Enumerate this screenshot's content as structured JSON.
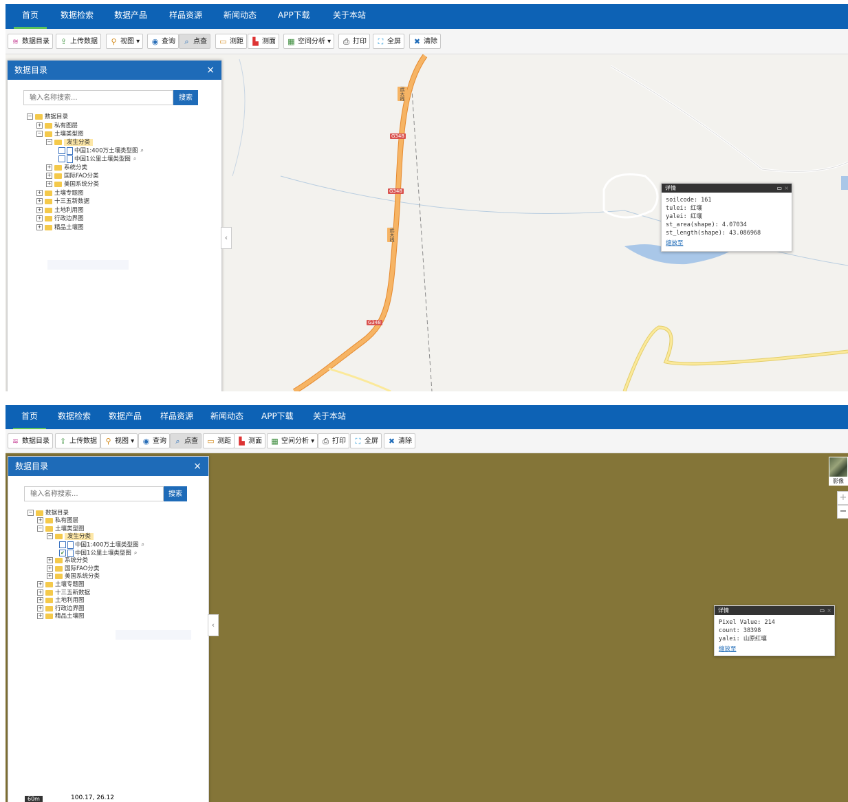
{
  "nav": {
    "items": [
      "首页",
      "数据检索",
      "数据产品",
      "样品资源",
      "新闻动态",
      "APP下载",
      "关于本站"
    ]
  },
  "toolbar": {
    "buttons": [
      {
        "label": "数据目录",
        "icon": "layers-icon"
      },
      {
        "label": "上传数据",
        "icon": "upload-icon"
      },
      {
        "label": "视图 ▾",
        "icon": "view-icon"
      },
      {
        "label": "查询",
        "icon": "query-icon"
      },
      {
        "label": "点查",
        "icon": "point-query-icon"
      },
      {
        "label": "测距",
        "icon": "ruler-icon"
      },
      {
        "label": "测面",
        "icon": "area-icon"
      },
      {
        "label": "空间分析 ▾",
        "icon": "analysis-icon"
      },
      {
        "label": "打印",
        "icon": "print-icon"
      },
      {
        "label": "全屏",
        "icon": "fullscreen-icon"
      },
      {
        "label": "清除",
        "icon": "clear-icon"
      }
    ]
  },
  "panel": {
    "title": "数据目录",
    "close": "×",
    "search_placeholder": "输入名称搜索...",
    "search_button": "搜索",
    "collapse": "‹",
    "tree": {
      "root": "数据目录",
      "private": "私有图层",
      "soil_type_map": "土壤类型图",
      "genetic": "发生分类",
      "map_400": "中国1:400万土壤类型图",
      "map_1km": "中国1公里土壤类型图",
      "system": "系统分类",
      "fao": "国际FAO分类",
      "usa": "美国系统分类",
      "thematic": "土壤专题图",
      "five_year": "十三五新数据",
      "land_use": "土地利用图",
      "admin": "行政边界图",
      "premium": "精品土壤图"
    }
  },
  "popup1": {
    "title": "详情",
    "lines": [
      "soilcode: 161",
      "tulei: 红壤",
      "yalei: 红壤",
      "st_area(shape): 4.07034",
      "st_length(shape): 43.086968"
    ],
    "link": "缩放至"
  },
  "popup2": {
    "title": "详情",
    "lines": [
      "Pixel Value: 214",
      "count: 38398",
      "yalei: 山原红壤"
    ],
    "link": "缩放至"
  },
  "map1": {
    "road_labels": [
      "武大线",
      "G348",
      "G348",
      "武大线",
      "G348",
      "武大线"
    ]
  },
  "map2": {
    "basemap_label": "影像",
    "zoom_in": "+",
    "zoom_out": "−",
    "scale": "60m",
    "coords": "100.17, 26.12"
  },
  "colors": {
    "nav": "#0d62b5",
    "panel_header": "#1e6bb8",
    "nav_active": "#5dc35a",
    "map2_bg": "#847538",
    "road": "#f6a24a"
  }
}
